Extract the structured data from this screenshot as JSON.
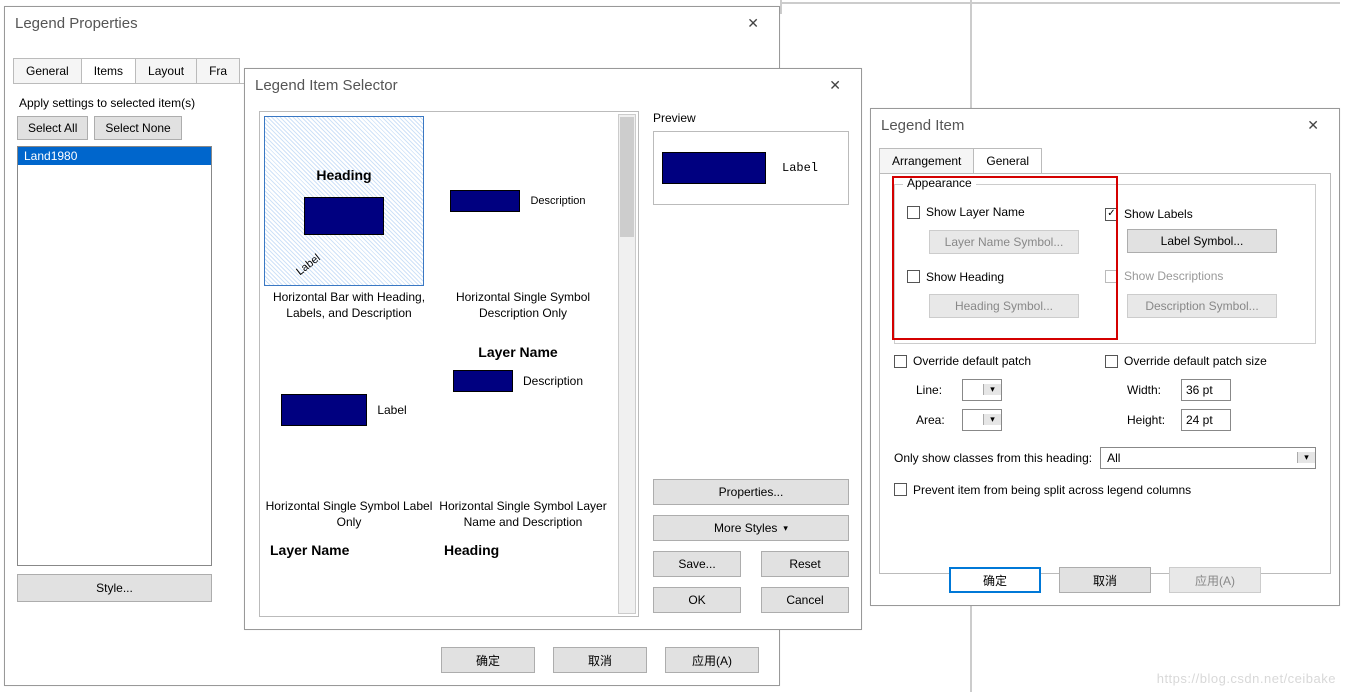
{
  "bg": {
    "watermark": "https://blog.csdn.net/ceibake"
  },
  "legendProps": {
    "title": "Legend Properties",
    "tabs": [
      "General",
      "Items",
      "Layout",
      "Fra"
    ],
    "activeTab": 1,
    "apply_label": "Apply settings to selected item(s)",
    "select_all": "Select All",
    "select_none": "Select None",
    "list_items": [
      "Land1980"
    ],
    "style_btn": "Style...",
    "ok": "确定",
    "cancel": "取消",
    "apply": "应用(A)"
  },
  "selector": {
    "title": "Legend Item Selector",
    "preview_label": "Preview",
    "preview_text": "Label",
    "items": [
      {
        "heading": "Heading",
        "extra": "Label",
        "caption": "Horizontal Bar with Heading, Labels, and Description",
        "selected": true
      },
      {
        "desc": "Description",
        "caption": "Horizontal Single Symbol Description Only"
      },
      {
        "label": "Label",
        "caption": "Horizontal Single Symbol Label Only"
      },
      {
        "top": "Layer Name",
        "desc": "Description",
        "caption": "Horizontal Single Symbol Layer Name and Description"
      },
      {
        "top": "Layer Name",
        "caption": ""
      },
      {
        "top": "Heading",
        "caption": ""
      }
    ],
    "properties_btn": "Properties...",
    "more_styles_btn": "More Styles",
    "save_btn": "Save...",
    "reset_btn": "Reset",
    "ok_btn": "OK",
    "cancel_btn": "Cancel"
  },
  "legendItem": {
    "title": "Legend Item",
    "tabs": [
      "Arrangement",
      "General"
    ],
    "activeTab": 1,
    "appearance_label": "Appearance",
    "show_layer_name": "Show Layer Name",
    "layer_name_symbol": "Layer Name Symbol...",
    "show_heading": "Show Heading",
    "heading_symbol": "Heading Symbol...",
    "show_labels": "Show Labels",
    "label_symbol": "Label Symbol...",
    "show_descriptions": "Show Descriptions",
    "description_symbol": "Description Symbol...",
    "override_patch": "Override default patch",
    "line_label": "Line:",
    "area_label": "Area:",
    "override_patch_size": "Override default patch size",
    "width_label": "Width:",
    "width_val": "36 pt",
    "height_label": "Height:",
    "height_val": "24 pt",
    "only_show_label": "Only show classes from this heading:",
    "only_show_val": "All",
    "prevent_split": "Prevent item from being split across legend columns",
    "ok": "确定",
    "cancel": "取消",
    "apply": "应用(A)"
  }
}
